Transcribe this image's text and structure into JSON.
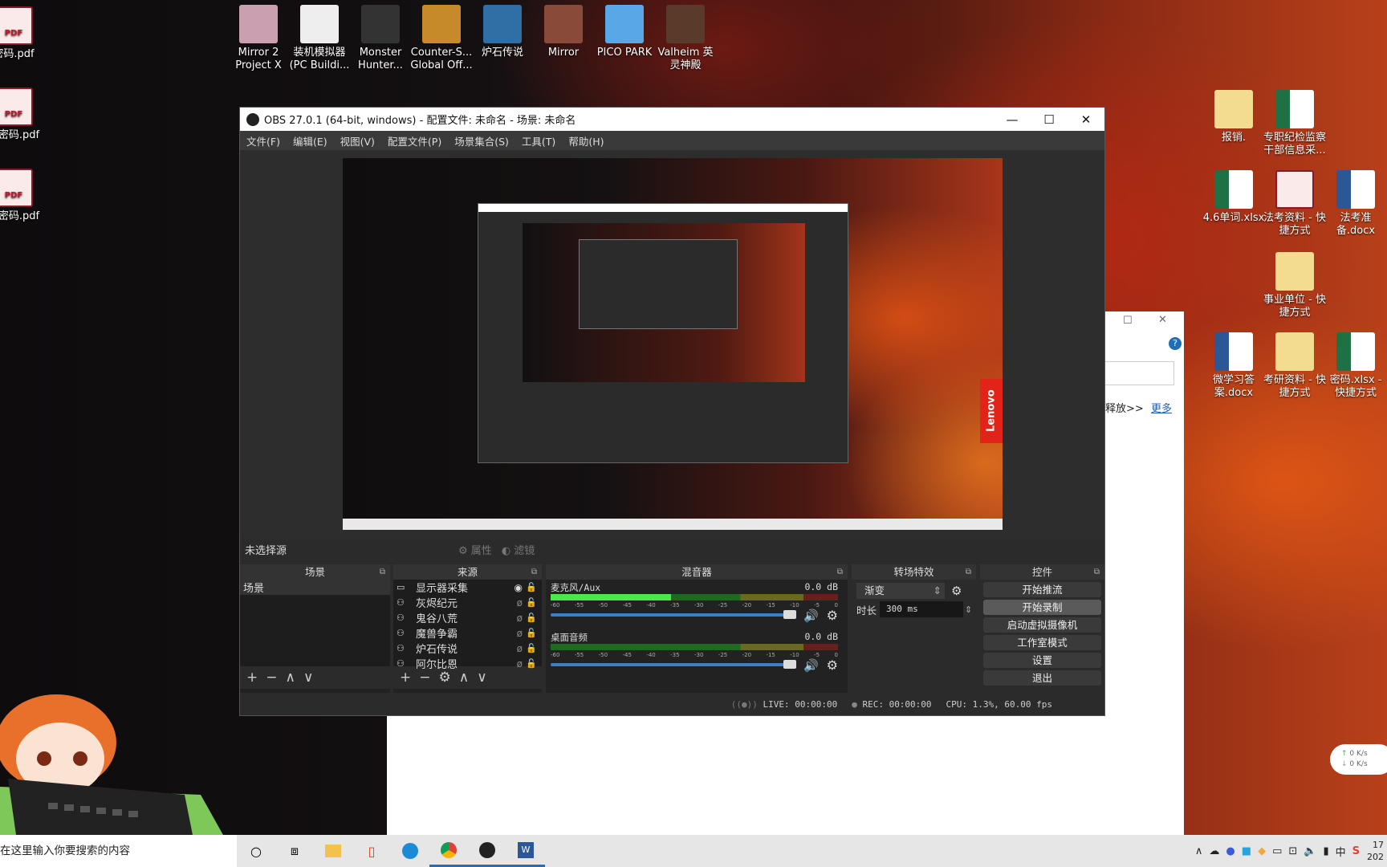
{
  "desktop": {
    "left_icons": [
      {
        "label": "密码.pdf"
      },
      {
        "label": "开密码.pdf"
      },
      {
        "label": "据密码.pdf"
      }
    ],
    "top_icons": [
      {
        "label": "Mirror 2 Project X"
      },
      {
        "label": "装机模拟器 (PC Buildi..."
      },
      {
        "label": "Monster Hunter..."
      },
      {
        "label": "Counter-S... Global Off..."
      },
      {
        "label": "炉石传说"
      },
      {
        "label": "Mirror"
      },
      {
        "label": "PICO PARK"
      },
      {
        "label": "Valheim 英灵神殿"
      }
    ],
    "right_icons": [
      {
        "label": "报销.",
        "type": "folder"
      },
      {
        "label": "专职纪检监察干部信息采...",
        "type": "xlsx"
      },
      {
        "label": "4.6单词.xlsx",
        "type": "xlsx"
      },
      {
        "label": "法考资料 - 快捷方式",
        "type": "pdf"
      },
      {
        "label": "法考准备.docx",
        "type": "docx"
      },
      {
        "label": "事业单位 - 快捷方式",
        "type": "folder"
      },
      {
        "label": "微学习答案.docx",
        "type": "docx"
      },
      {
        "label": "考研资料 - 快捷方式",
        "type": "folder"
      },
      {
        "label": "密码.xlsx - 快捷方式",
        "type": "xlsx"
      }
    ]
  },
  "obs": {
    "title": "OBS 27.0.1 (64-bit, windows) - 配置文件: 未命名 - 场景: 未命名",
    "menu": [
      "文件(F)",
      "编辑(E)",
      "视图(V)",
      "配置文件(P)",
      "场景集合(S)",
      "工具(T)",
      "帮助(H)"
    ],
    "preview_brand": "Lenovo",
    "no_source": "未选择源",
    "properties": "属性",
    "filters": "滤镜",
    "scenes": {
      "title": "场景",
      "items": [
        "场景"
      ]
    },
    "sources": {
      "title": "来源",
      "items": [
        {
          "name": "显示器采集",
          "icon": "monitor-icon",
          "visible": true
        },
        {
          "name": "灰烬纪元",
          "icon": "gamepad-icon",
          "visible": false
        },
        {
          "name": "鬼谷八荒",
          "icon": "gamepad-icon",
          "visible": false
        },
        {
          "name": "魔兽争霸",
          "icon": "gamepad-icon",
          "visible": false
        },
        {
          "name": "炉石传说",
          "icon": "gamepad-icon",
          "visible": false
        },
        {
          "name": "阿尔比恩",
          "icon": "gamepad-icon",
          "visible": false
        }
      ]
    },
    "mixer": {
      "title": "混音器",
      "ticks": [
        "-60",
        "-55",
        "-50",
        "-45",
        "-40",
        "-35",
        "-30",
        "-25",
        "-20",
        "-15",
        "-10",
        "-5",
        "0"
      ],
      "channels": [
        {
          "name": "麦克风/Aux",
          "db": "0.0 dB",
          "level": 0.42,
          "volume": 1.0
        },
        {
          "name": "桌面音频",
          "db": "0.0 dB",
          "level": 0,
          "volume": 1.0
        }
      ]
    },
    "transitions": {
      "title": "转场特效",
      "type": "渐变",
      "duration_label": "时长",
      "duration": "300 ms"
    },
    "controls": {
      "title": "控件",
      "buttons": [
        "开始推流",
        "开始录制",
        "启动虚拟摄像机",
        "工作室模式",
        "设置",
        "退出"
      ]
    },
    "status": {
      "live": "LIVE: 00:00:00",
      "rec": "REC: 00:00:00",
      "cpu": "CPU: 1.3%, 60.00 fps"
    }
  },
  "dialog": {
    "release": "释放>>",
    "more": "更多"
  },
  "taskbar": {
    "search_placeholder": "在这里输入你要搜索的内容",
    "ime": "中",
    "time": "17",
    "date": "202"
  },
  "net": {
    "up": "0  K/s",
    "down": "0  K/s"
  }
}
